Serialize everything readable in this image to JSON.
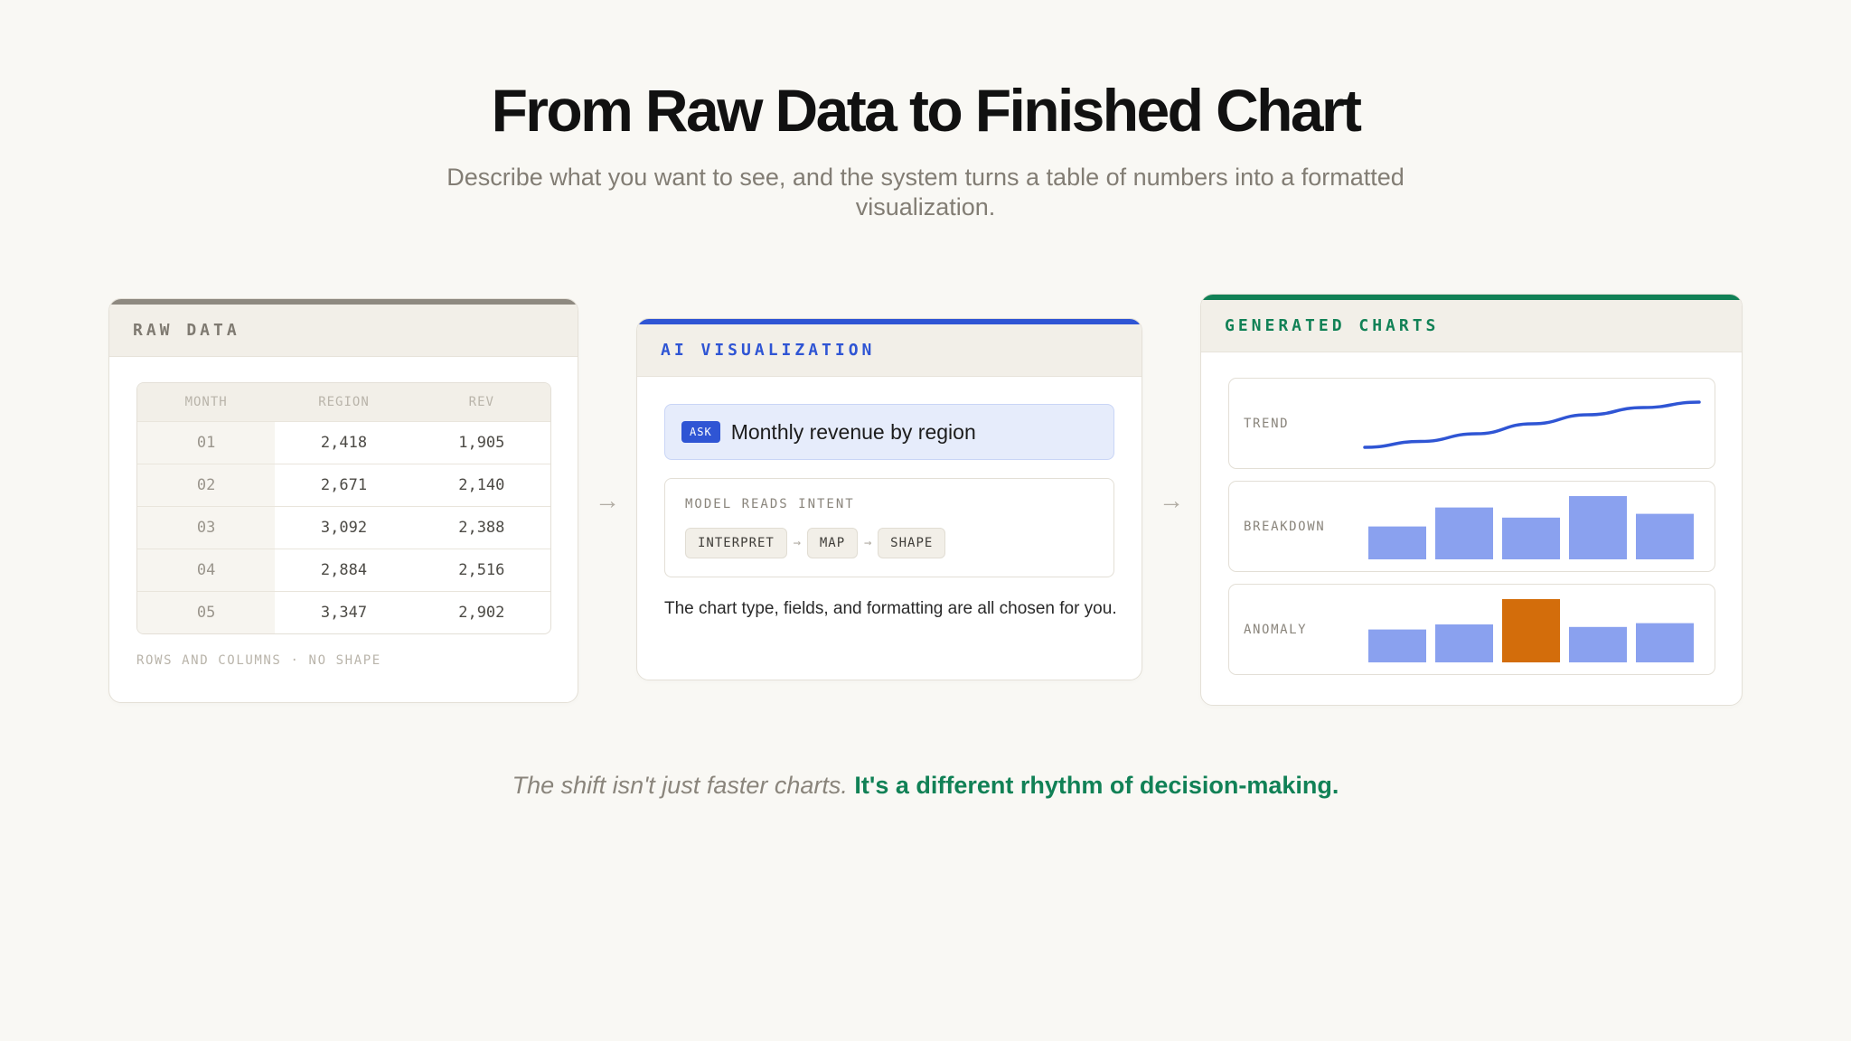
{
  "header": {
    "title": "From Raw Data to Finished Chart",
    "subtitle": "Describe what you want to see, and the system turns a table of numbers into a formatted visualization."
  },
  "raw_card": {
    "label": "RAW DATA",
    "columns": [
      "MONTH",
      "REGION",
      "REV"
    ],
    "rows": [
      [
        "01",
        "2,418",
        "1,905"
      ],
      [
        "02",
        "2,671",
        "2,140"
      ],
      [
        "03",
        "3,092",
        "2,388"
      ],
      [
        "04",
        "2,884",
        "2,516"
      ],
      [
        "05",
        "3,347",
        "2,902"
      ]
    ],
    "footer": "ROWS AND COLUMNS · NO SHAPE"
  },
  "arrows": {
    "glyph": "→"
  },
  "ai_card": {
    "label": "AI VISUALIZATION",
    "ask_badge": "ASK",
    "prompt": "Monthly revenue by region",
    "intent_label": "MODEL READS INTENT",
    "steps": [
      "INTERPRET",
      "MAP",
      "SHAPE"
    ],
    "step_arrow": "→",
    "description": "The chart type, fields, and formatting are all chosen for you."
  },
  "gen_card": {
    "label": "GENERATED CHARTS",
    "panels": [
      {
        "label": "TREND",
        "type": "line",
        "values": [
          0,
          0.13,
          0.3,
          0.52,
          0.72,
          0.88,
          1.0
        ]
      },
      {
        "label": "BREAKDOWN",
        "type": "bar",
        "values": [
          0.52,
          0.82,
          0.66,
          1.0,
          0.72
        ]
      },
      {
        "label": "ANOMALY",
        "type": "bar",
        "values": [
          0.52,
          0.6,
          1.0,
          0.56,
          0.62
        ],
        "highlight_index": 2
      }
    ]
  },
  "tagline": {
    "lead": "The shift isn't just faster charts.",
    "accent": "It's a different rhythm of decision-making."
  },
  "colors": {
    "background": "#f9f8f4",
    "raw_accent": "#8e8980",
    "ai_accent": "#2f55d4",
    "gen_accent": "#118156",
    "bar": "#8aa1ef",
    "anomaly": "#d36d0b",
    "trend_line": "#2f55d4"
  }
}
